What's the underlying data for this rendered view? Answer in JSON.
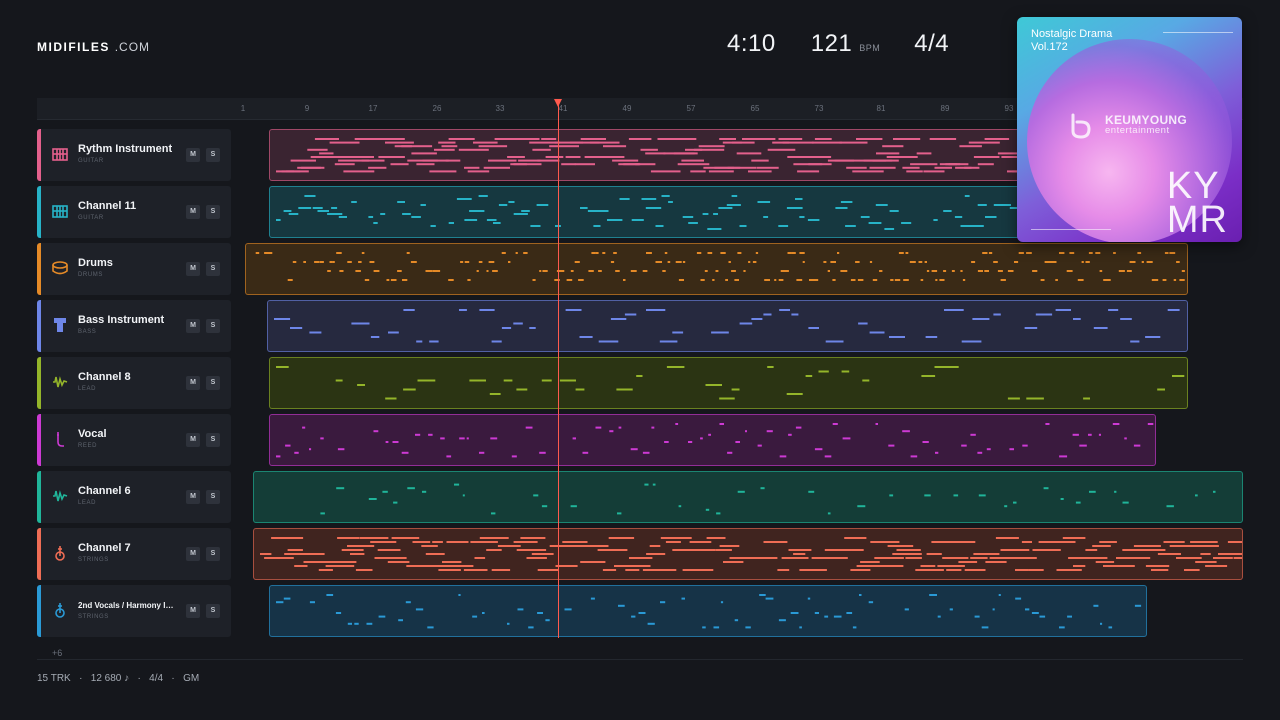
{
  "brand": {
    "name": "MIDIFILES",
    "suffix": ".COM"
  },
  "transport": {
    "duration": "4:10",
    "tempo": "121",
    "tempo_unit": "BPM",
    "time_signature": "4/4"
  },
  "ruler": {
    "bars": [
      "1",
      "9",
      "17",
      "26",
      "33",
      "41",
      "49",
      "57",
      "65",
      "73",
      "81",
      "89",
      "93"
    ]
  },
  "tracks": [
    {
      "name": "Rythm Instrument",
      "type": "GUITAR",
      "color": "#e4608c",
      "icon": "grid-instrument-icon",
      "mute": "M",
      "solo": "S"
    },
    {
      "name": "Channel 11",
      "type": "GUITAR",
      "color": "#27b3c7",
      "icon": "grid-instrument-icon",
      "mute": "M",
      "solo": "S"
    },
    {
      "name": "Drums",
      "type": "DRUMS",
      "color": "#e58a27",
      "icon": "drum-icon",
      "mute": "M",
      "solo": "S"
    },
    {
      "name": "Bass Instrument",
      "type": "BASS",
      "color": "#6e86e8",
      "icon": "bass-icon",
      "mute": "M",
      "solo": "S"
    },
    {
      "name": "Channel 8",
      "type": "LEAD",
      "color": "#94b52a",
      "icon": "waveform-icon",
      "mute": "M",
      "solo": "S"
    },
    {
      "name": "Vocal",
      "type": "REED",
      "color": "#cd3ad4",
      "icon": "reed-icon",
      "mute": "M",
      "solo": "S"
    },
    {
      "name": "Channel 6",
      "type": "LEAD",
      "color": "#20b59a",
      "icon": "waveform-icon",
      "mute": "M",
      "solo": "S"
    },
    {
      "name": "Channel 7",
      "type": "STRINGS",
      "color": "#ef6d55",
      "icon": "violin-icon",
      "mute": "M",
      "solo": "S"
    },
    {
      "name": "2nd Vocals / Harmony Ins...",
      "type": "STRINGS",
      "color": "#2a9ad6",
      "icon": "violin-icon",
      "mute": "M",
      "solo": "S"
    }
  ],
  "more_tracks": "+6",
  "footer": {
    "tracks": "15 TRK",
    "notes": "12 680 ♪",
    "meter": "4/4",
    "standard": "GM",
    "separator": "·"
  },
  "album": {
    "title": "Nostalgic Drama",
    "volume": "Vol.172",
    "label_name": "KEUMYOUNG",
    "label_sub": "entertainment",
    "mark_top": "KY",
    "mark_bottom": "MR"
  }
}
